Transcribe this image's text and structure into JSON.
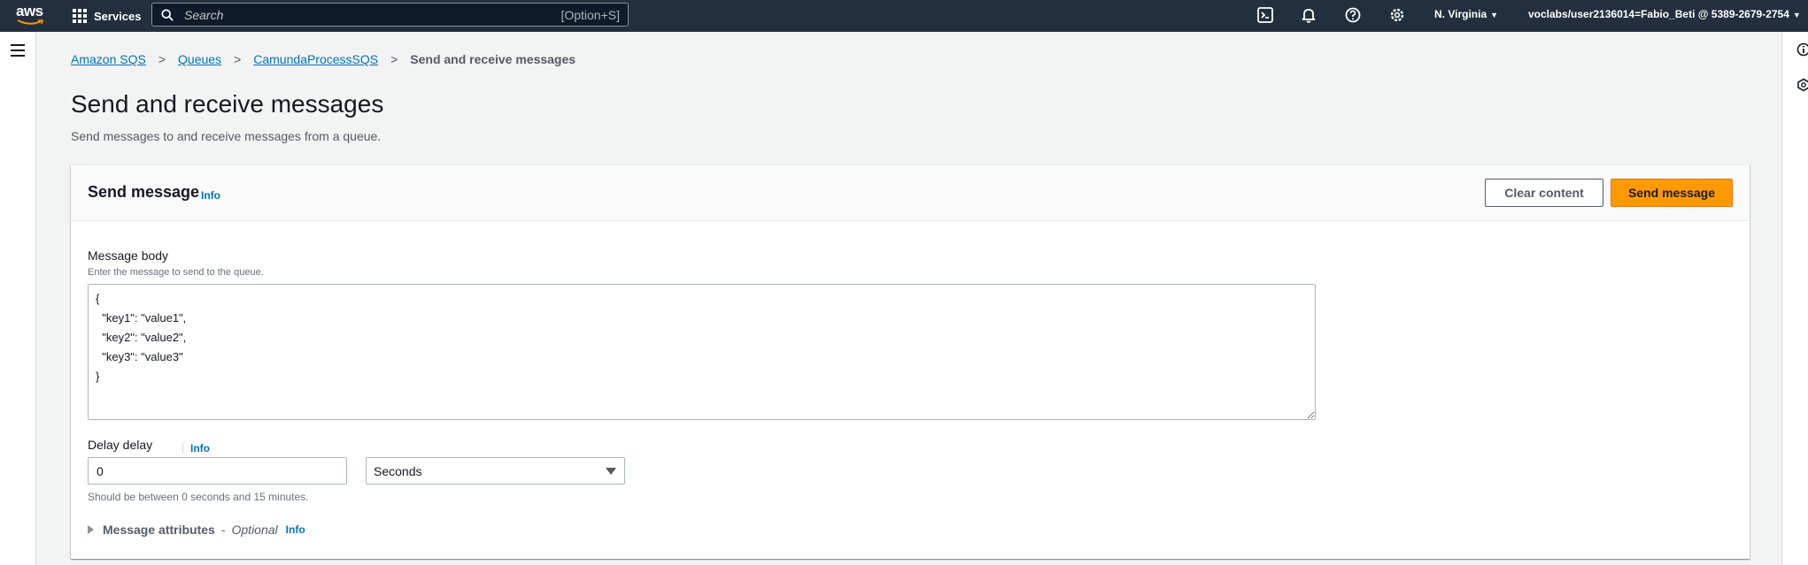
{
  "nav": {
    "services_label": "Services",
    "search_placeholder": "Search",
    "search_shortcut": "[Option+S]",
    "region": "N. Virginia",
    "account": "voclabs/user2136014=Fabio_Beti @ 5389-2679-2754",
    "icons": [
      "cloudshell-icon",
      "bell-icon",
      "help-icon",
      "gear-icon"
    ]
  },
  "breadcrumb": {
    "items": [
      "Amazon SQS",
      "Queues",
      "CamundaProcessSQS"
    ],
    "current": "Send and receive messages"
  },
  "page": {
    "title": "Send and receive messages",
    "description": "Send messages to and receive messages from a queue."
  },
  "send_message": {
    "title": "Send message",
    "info": "Info",
    "clear_label": "Clear content",
    "send_label": "Send message",
    "body_label": "Message body",
    "body_hint": "Enter the message to send to the queue.",
    "body_value": "{\n  \"key1\": \"value1\",\n  \"key2\": \"value2\",\n  \"key3\": \"value3\"\n}",
    "delay_label": "Delay delay",
    "delay_info": "Info",
    "delay_value": "0",
    "delay_unit": "Seconds",
    "delay_hint": "Should be between 0 seconds and 15 minutes.",
    "attrs_title": "Message attributes",
    "attrs_optional": "Optional",
    "attrs_info": "Info"
  },
  "colors": {
    "nav_bg": "#232f3e",
    "link": "#0073bb",
    "primary_button": "#ff9900"
  }
}
